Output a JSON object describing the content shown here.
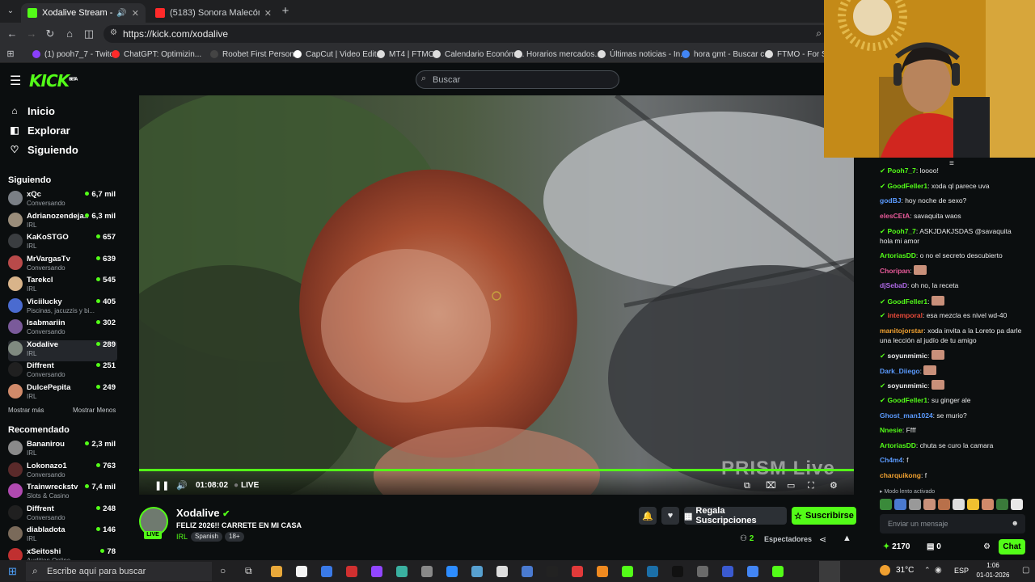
{
  "browser": {
    "tabs": [
      {
        "title": "Xodalive Stream - Watch Li",
        "active": true
      },
      {
        "title": "(5183) Sonora Malecón - Dond",
        "active": false
      }
    ],
    "url": "https://kick.com/xodalive",
    "bookmarks": [
      "(1) pooh7_7 - Twitch",
      "ChatGPT: Optimizin...",
      "Roobet First Person...",
      "CapCut | Video Edit...",
      "MT4 | FTMO",
      "Calendario Económi...",
      "Horarios mercados...",
      "Últimas noticias - In...",
      "hora gmt - Buscar c...",
      "FTMO - For Serio"
    ]
  },
  "header": {
    "logo": "KICK",
    "logo_sup": "BETA",
    "search_placeholder": "Buscar"
  },
  "sidebar": {
    "nav": [
      {
        "label": "Inicio",
        "icon": "home-icon"
      },
      {
        "label": "Explorar",
        "icon": "compass-icon"
      },
      {
        "label": "Siguiendo",
        "icon": "heart-icon"
      }
    ],
    "following_title": "Siguiendo",
    "following": [
      {
        "name": "xQc",
        "category": "Conversando",
        "viewers": "6,7 mil",
        "color": "#7a7f85"
      },
      {
        "name": "Adrianozendeja...",
        "category": "IRL",
        "viewers": "6,3 mil",
        "color": "#9a8d7a"
      },
      {
        "name": "KaKoSTGO",
        "category": "IRL",
        "viewers": "657",
        "color": "#3a3d40"
      },
      {
        "name": "MrVargasTv",
        "category": "Conversando",
        "viewers": "639",
        "color": "#b84a4a"
      },
      {
        "name": "Tarekcl",
        "category": "IRL",
        "viewers": "545",
        "color": "#d9b48a"
      },
      {
        "name": "Viciilucky",
        "category": "Piscinas, jacuzzis y bi...",
        "viewers": "405",
        "color": "#4a6bd0"
      },
      {
        "name": "Isabmariin",
        "category": "Conversando",
        "viewers": "302",
        "color": "#7a5a9a"
      },
      {
        "name": "Xodalive",
        "category": "IRL",
        "viewers": "289",
        "color": "#808a80",
        "selected": true
      },
      {
        "name": "Diffrent",
        "category": "Conversando",
        "viewers": "251",
        "color": "#202020"
      },
      {
        "name": "DulcePepita",
        "category": "IRL",
        "viewers": "249",
        "color": "#d08a6a"
      }
    ],
    "show_more": "Mostrar más",
    "show_less": "Mostrar Menos",
    "recommended_title": "Recomendado",
    "recommended": [
      {
        "name": "Bananirou",
        "category": "IRL",
        "viewers": "2,3 mil",
        "color": "#8a8a8a"
      },
      {
        "name": "Lokonazo1",
        "category": "Conversando",
        "viewers": "763",
        "color": "#5a2a2a"
      },
      {
        "name": "Trainwreckstv",
        "category": "Slots & Casino",
        "viewers": "7,4 mil",
        "color": "#b04ab0"
      },
      {
        "name": "Diffrent",
        "category": "Conversando",
        "viewers": "248",
        "color": "#202020"
      },
      {
        "name": "diabladota",
        "category": "IRL",
        "viewers": "146",
        "color": "#7a6a5a"
      },
      {
        "name": "xSeitoshi",
        "category": "Audition Online",
        "viewers": "78",
        "color": "#c03030"
      }
    ]
  },
  "player": {
    "elapsed": "01:08:02",
    "live_label": "LIVE",
    "watermark": "PRISM Live",
    "progress": 1.0
  },
  "stream": {
    "name": "Xodalive",
    "title": "FELIZ 2026!! CARRETE EN MI CASA",
    "category": "IRL",
    "tags": [
      "Spanish",
      "18+"
    ],
    "live_badge": "LIVE",
    "gift_subs": "Regala Suscripciones",
    "subscribe": "Suscribirse",
    "viewers_count": "2",
    "viewers_label": "Espectadores"
  },
  "chat": {
    "messages": [
      {
        "user": "Pooh7_7",
        "text": "loooo!",
        "color": "#53fc18",
        "badges": true
      },
      {
        "user": "GoodFeller1",
        "text": "xoda ql parece uva",
        "color": "#53fc18",
        "badges": true
      },
      {
        "user": "godBJ",
        "text": "hoy noche de sexo?",
        "color": "#5b9bff"
      },
      {
        "user": "elesCEtA",
        "text": "savaquita waos",
        "color": "#e85a9a"
      },
      {
        "user": "Pooh7_7",
        "text": "ASKJDAKJSDAS @savaquita hola mi amor",
        "color": "#53fc18",
        "badges": true
      },
      {
        "user": "ArtoriasDD",
        "text": "o no el secreto descubierto",
        "color": "#53fc18"
      },
      {
        "user": "Choripan",
        "text": "",
        "color": "#e85a9a",
        "emote": true
      },
      {
        "user": "djSebaD",
        "text": "oh no, la receta",
        "color": "#b06ae8"
      },
      {
        "user": "GoodFeller1",
        "text": "",
        "color": "#53fc18",
        "badges": true,
        "emote": true
      },
      {
        "user": "intemporal",
        "text": "esa mezcla es nivel wd-40",
        "color": "#e84a3a",
        "badges": true
      },
      {
        "user": "manitojorstar",
        "text": "xoda invita a la Loreto pa darle una lección al judío de tu amigo",
        "color": "#f0a030"
      },
      {
        "user": "soyunmimic",
        "text": "",
        "color": "#e9eaeb",
        "badges": true,
        "emote": true
      },
      {
        "user": "Dark_Diiego",
        "text": "",
        "color": "#5b9bff",
        "emote": true
      },
      {
        "user": "soyunmimic",
        "text": "",
        "color": "#e9eaeb",
        "badges": true,
        "emote": true
      },
      {
        "user": "GoodFeller1",
        "text": "su ginger ale",
        "color": "#53fc18",
        "badges": true
      },
      {
        "user": "Ghost_man1024",
        "text": "se murio?",
        "color": "#5b9bff"
      },
      {
        "user": "Nnesie",
        "text": "Ffff",
        "color": "#53fc18"
      },
      {
        "user": "ArtoriasDD",
        "text": "chuta se curo la camara",
        "color": "#53fc18"
      },
      {
        "user": "Ch4m4",
        "text": "f",
        "color": "#5b9bff"
      },
      {
        "user": "charquikong",
        "text": "f",
        "color": "#f0a030"
      }
    ],
    "slow_mode": "Modo lento activado",
    "input_placeholder": "Enviar un mensaje",
    "points": "2170",
    "bits": "0",
    "chat_button": "Chat"
  },
  "taskbar": {
    "search_placeholder": "Escribe aquí para buscar",
    "temperature": "31°C",
    "language": "ESP",
    "time": "1:06",
    "date": "01-01-2026"
  }
}
